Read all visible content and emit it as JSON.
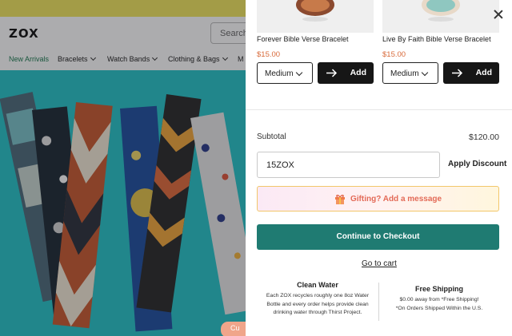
{
  "store": {
    "logo": "ZOX",
    "search_placeholder": "Search f",
    "nav": [
      {
        "label": "New Arrivals",
        "has_menu": false
      },
      {
        "label": "Bracelets",
        "has_menu": true
      },
      {
        "label": "Watch Bands",
        "has_menu": true
      },
      {
        "label": "Clothing & Bags",
        "has_menu": true
      },
      {
        "label": "M",
        "has_menu": false
      }
    ],
    "hero_button_label": "Cu"
  },
  "cart": {
    "products": [
      {
        "name": "Forever Bible Verse Bracelet",
        "price": "$15.00",
        "size": "Medium",
        "add_label": "Add"
      },
      {
        "name": "Live By Faith Bible Verse Bracelet",
        "price": "$15.00",
        "size": "Medium",
        "add_label": "Add"
      }
    ],
    "subtotal_label": "Subtotal",
    "subtotal_value": "$120.00",
    "discount_code": "15ZOX",
    "apply_label": "Apply Discount",
    "gift_label": "Gifting? Add a message",
    "checkout_label": "Continue to Checkout",
    "go_to_cart_label": "Go to cart",
    "info": [
      {
        "title": "Clean Water",
        "lines": [
          "Each ZOX recycles roughly one 8oz Water",
          "Bottle and every order helps provide clean",
          "drinking water through Thirst Project."
        ]
      },
      {
        "title": "Free Shipping",
        "lines": [
          "$0.00 away from *Free Shipping!",
          "*On Orders Shipped Within the U.S."
        ]
      }
    ]
  },
  "colors": {
    "promo_bar": "#f1e75e",
    "hero_teal": "#26c4c9",
    "price_orange": "#d86a3a",
    "checkout_green": "#1f7b72",
    "nav_active_green": "#1b7a50",
    "gift_text": "#e36a57",
    "gift_border": "#f2c76a"
  },
  "icons": [
    "close-icon",
    "chevron-down-icon",
    "arrow-right-icon",
    "gift-icon"
  ]
}
